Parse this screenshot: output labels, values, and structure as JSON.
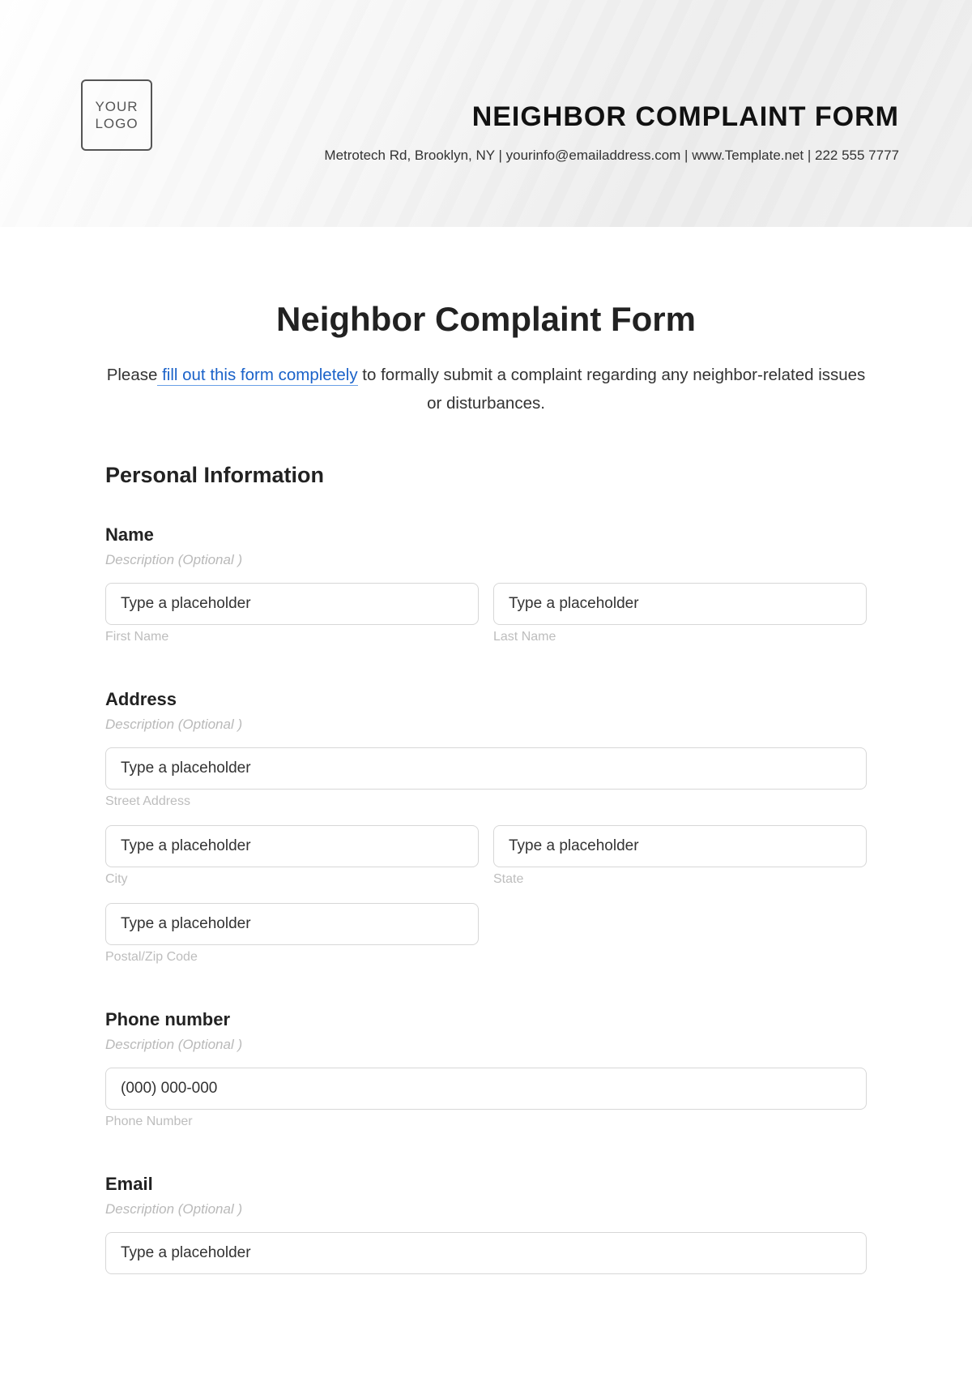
{
  "header": {
    "logo_text": "YOUR LOGO",
    "title_small": "NEIGHBOR COMPLAINT FORM",
    "contact_line": "Metrotech Rd, Brooklyn, NY | yourinfo@emailaddress.com | www.Template.net | 222 555 7777"
  },
  "page": {
    "title": "Neighbor Complaint Form",
    "intro_prefix": "Please",
    "intro_link": " fill out this form completely",
    "intro_suffix": " to formally submit a complaint regarding any neighbor-related issues or disturbances."
  },
  "section": {
    "personal_info": "Personal Information"
  },
  "fields": {
    "name": {
      "label": "Name",
      "desc": "Description  (Optional )",
      "first_placeholder": "Type a placeholder",
      "last_placeholder": "Type a placeholder",
      "first_sub": "First Name",
      "last_sub": "Last Name"
    },
    "address": {
      "label": "Address",
      "desc": "Description  (Optional )",
      "street_placeholder": "Type a placeholder",
      "street_sub": "Street Address",
      "city_placeholder": "Type a placeholder",
      "city_sub": "City",
      "state_placeholder": "Type a placeholder",
      "state_sub": "State",
      "zip_placeholder": "Type a placeholder",
      "zip_sub": "Postal/Zip Code"
    },
    "phone": {
      "label": "Phone number",
      "desc": "Description  (Optional )",
      "placeholder": "(000) 000-000",
      "sub": "Phone Number"
    },
    "email": {
      "label": "Email",
      "desc": "Description  (Optional )",
      "placeholder": "Type a placeholder"
    }
  }
}
